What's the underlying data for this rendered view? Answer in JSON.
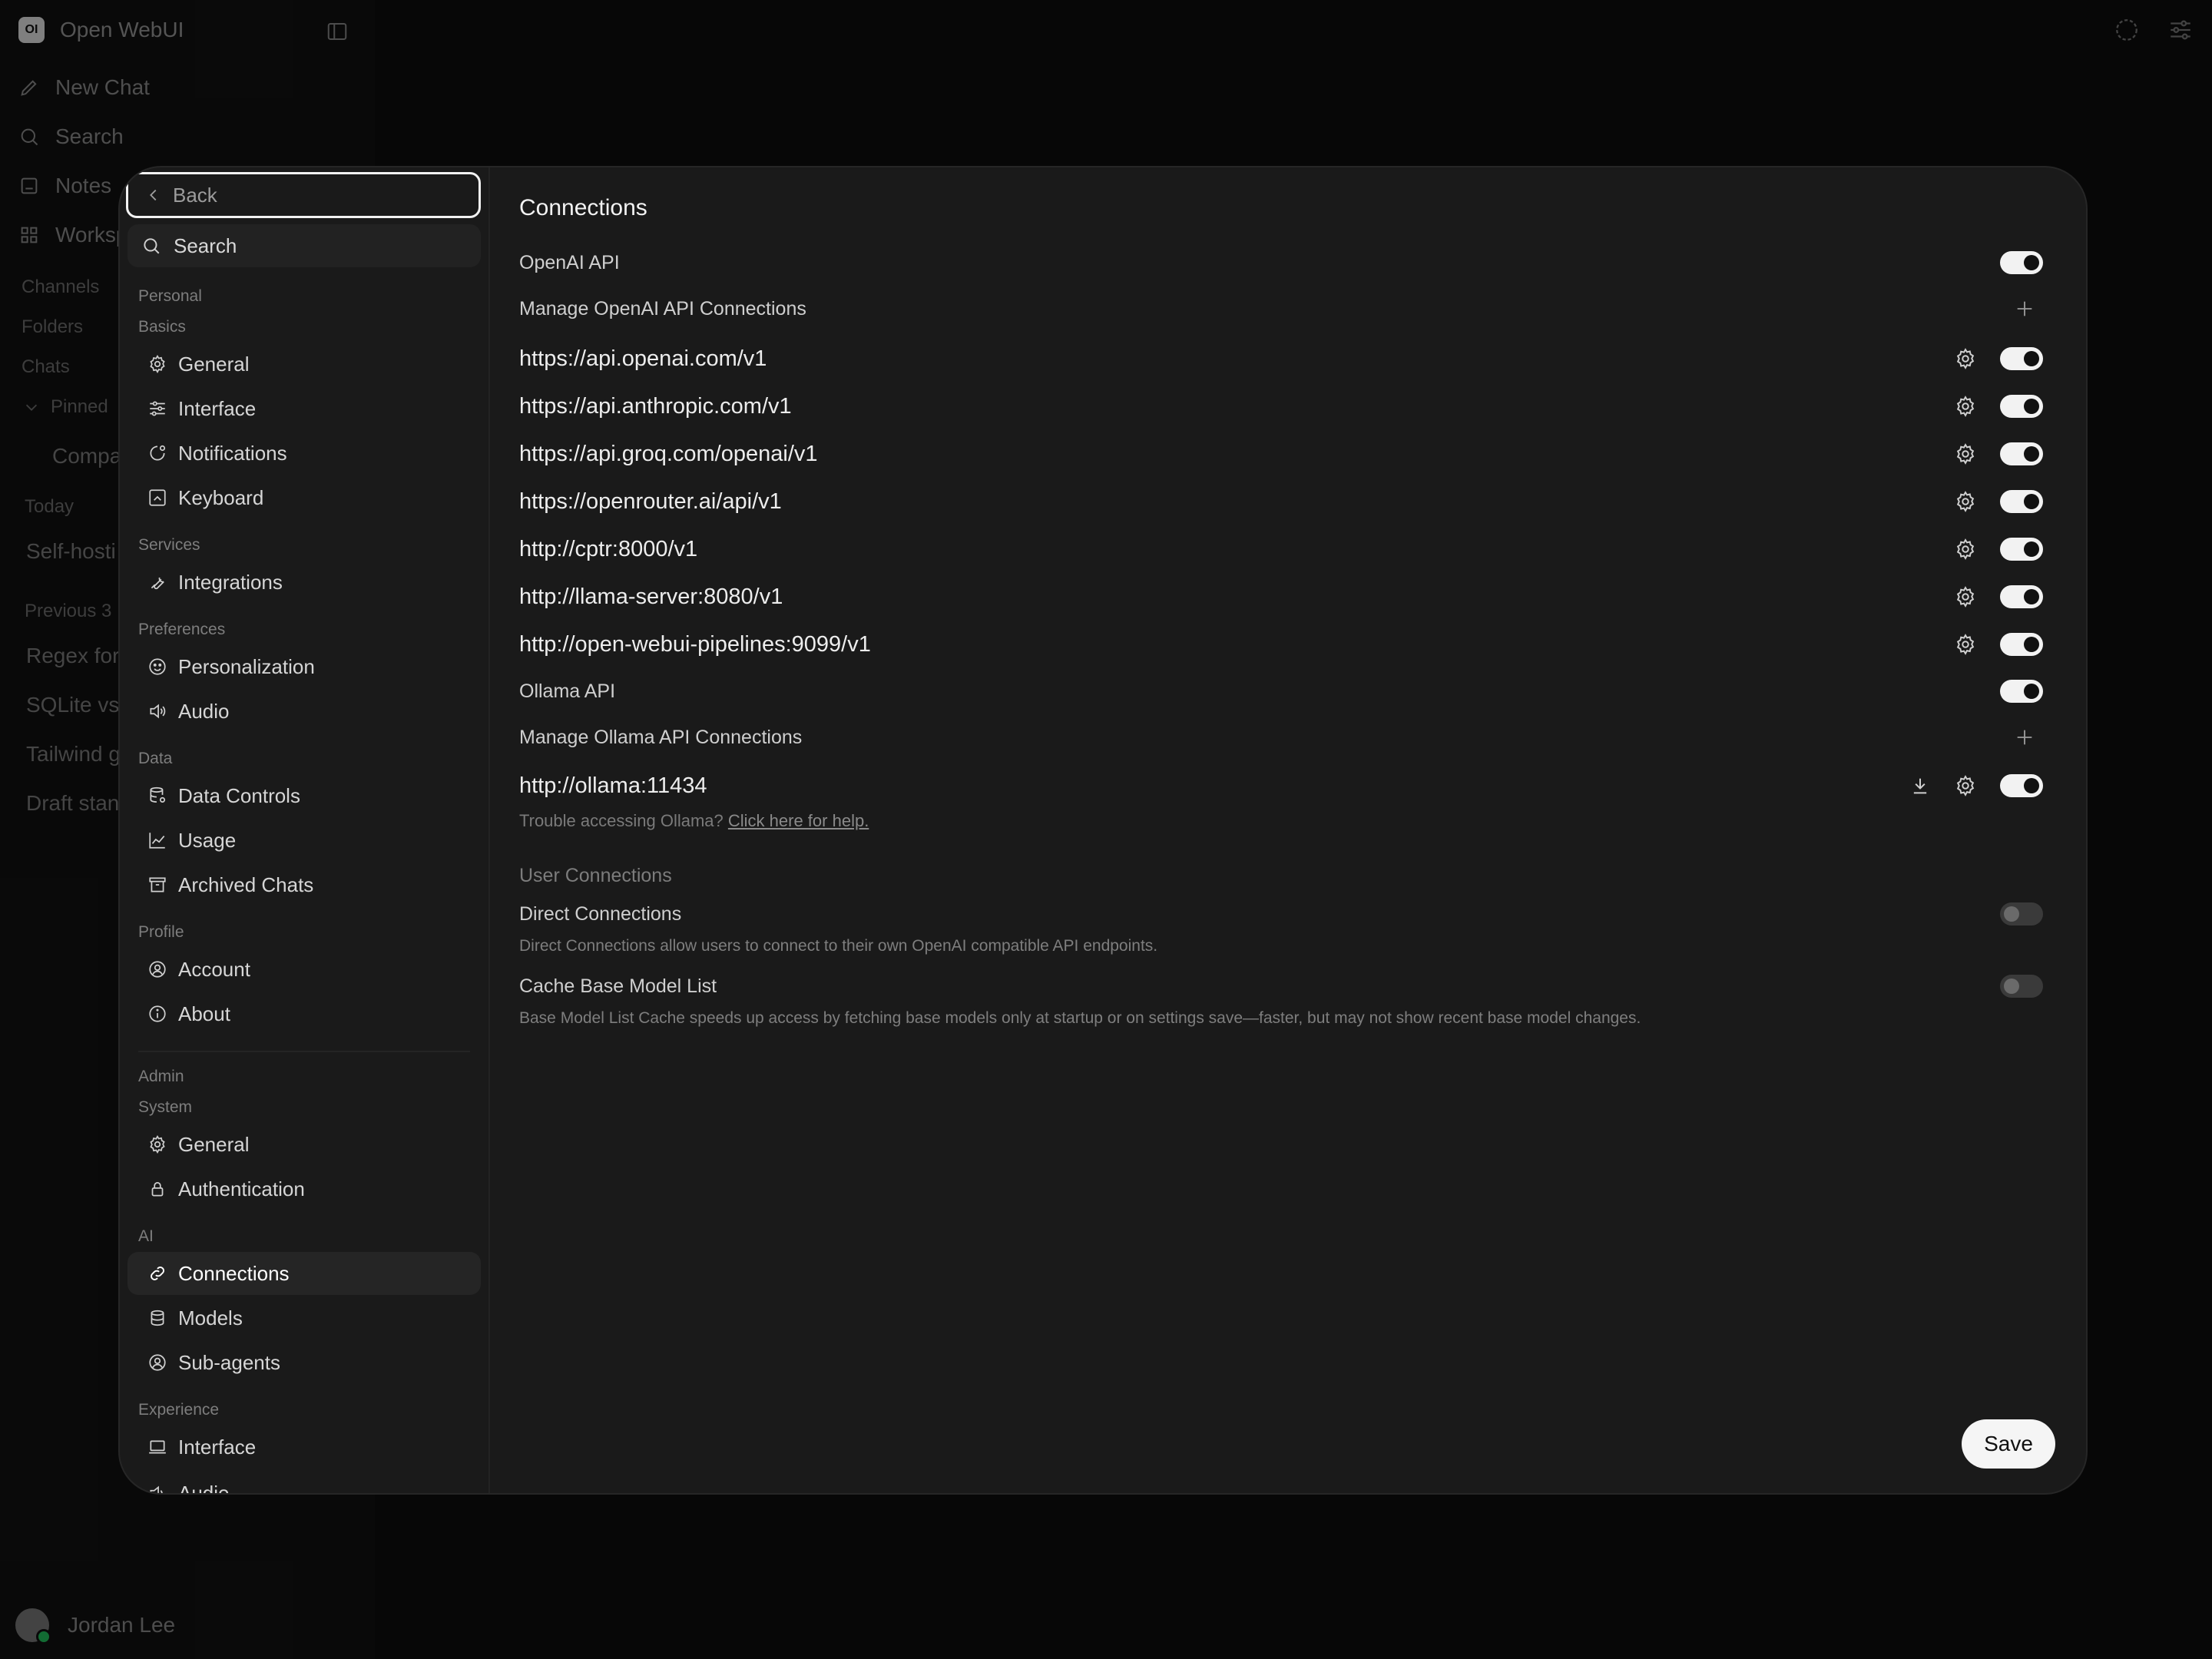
{
  "app": {
    "name": "Open WebUI",
    "logo_text": "OI",
    "nav": [
      {
        "label": "New Chat",
        "icon": "pencil-icon"
      },
      {
        "label": "Search",
        "icon": "search-icon"
      },
      {
        "label": "Notes",
        "icon": "note-icon"
      },
      {
        "label": "Worksp",
        "icon": "grid-icon"
      }
    ],
    "sections": {
      "channels": "Channels",
      "folders": "Folders",
      "chats": "Chats",
      "pinned": "Pinned",
      "today": "Today",
      "previous": "Previous 3"
    },
    "chats": {
      "pinned_item": "Compa",
      "today_item": "Self-hosti",
      "previous_items": [
        "Regex for",
        "SQLite vs",
        "Tailwind g",
        "Draft stan"
      ]
    },
    "user": {
      "name": "Jordan Lee"
    }
  },
  "settings": {
    "back_label": "Back",
    "search_label": "Search",
    "headings": {
      "personal": "Personal",
      "basics": "Basics",
      "services": "Services",
      "preferences": "Preferences",
      "data": "Data",
      "profile": "Profile",
      "admin": "Admin",
      "system": "System",
      "ai": "AI",
      "experience": "Experience"
    },
    "items": {
      "general": "General",
      "interface": "Interface",
      "notifications": "Notifications",
      "keyboard": "Keyboard",
      "integrations": "Integrations",
      "personalization": "Personalization",
      "audio": "Audio",
      "data_controls": "Data Controls",
      "usage": "Usage",
      "archived_chats": "Archived Chats",
      "account": "Account",
      "about": "About",
      "admin_general": "General",
      "authentication": "Authentication",
      "connections": "Connections",
      "models": "Models",
      "sub_agents": "Sub-agents",
      "exp_interface": "Interface",
      "exp_audio": "Audio"
    },
    "active_item": "Connections"
  },
  "connections": {
    "title": "Connections",
    "openai_label": "OpenAI API",
    "openai_enabled": true,
    "manage_openai_label": "Manage OpenAI API Connections",
    "openai_urls": [
      {
        "url": "https://api.openai.com/v1",
        "enabled": true
      },
      {
        "url": "https://api.anthropic.com/v1",
        "enabled": true
      },
      {
        "url": "https://api.groq.com/openai/v1",
        "enabled": true
      },
      {
        "url": "https://openrouter.ai/api/v1",
        "enabled": true
      },
      {
        "url": "http://cptr:8000/v1",
        "enabled": true
      },
      {
        "url": "http://llama-server:8080/v1",
        "enabled": true
      },
      {
        "url": "http://open-webui-pipelines:9099/v1",
        "enabled": true
      }
    ],
    "ollama_label": "Ollama API",
    "ollama_enabled": true,
    "manage_ollama_label": "Manage Ollama API Connections",
    "ollama_url": "http://ollama:11434",
    "ollama_url_enabled": true,
    "help_text": "Trouble accessing Ollama?",
    "help_link": "Click here for help.",
    "user_connections_heading": "User Connections",
    "direct_label": "Direct Connections",
    "direct_enabled": false,
    "direct_desc": "Direct Connections allow users to connect to their own OpenAI compatible API endpoints.",
    "cache_label": "Cache Base Model List",
    "cache_enabled": false,
    "cache_desc": "Base Model List Cache speeds up access by fetching base models only at startup or on settings save—faster, but may not show recent base model changes.",
    "save_label": "Save"
  }
}
